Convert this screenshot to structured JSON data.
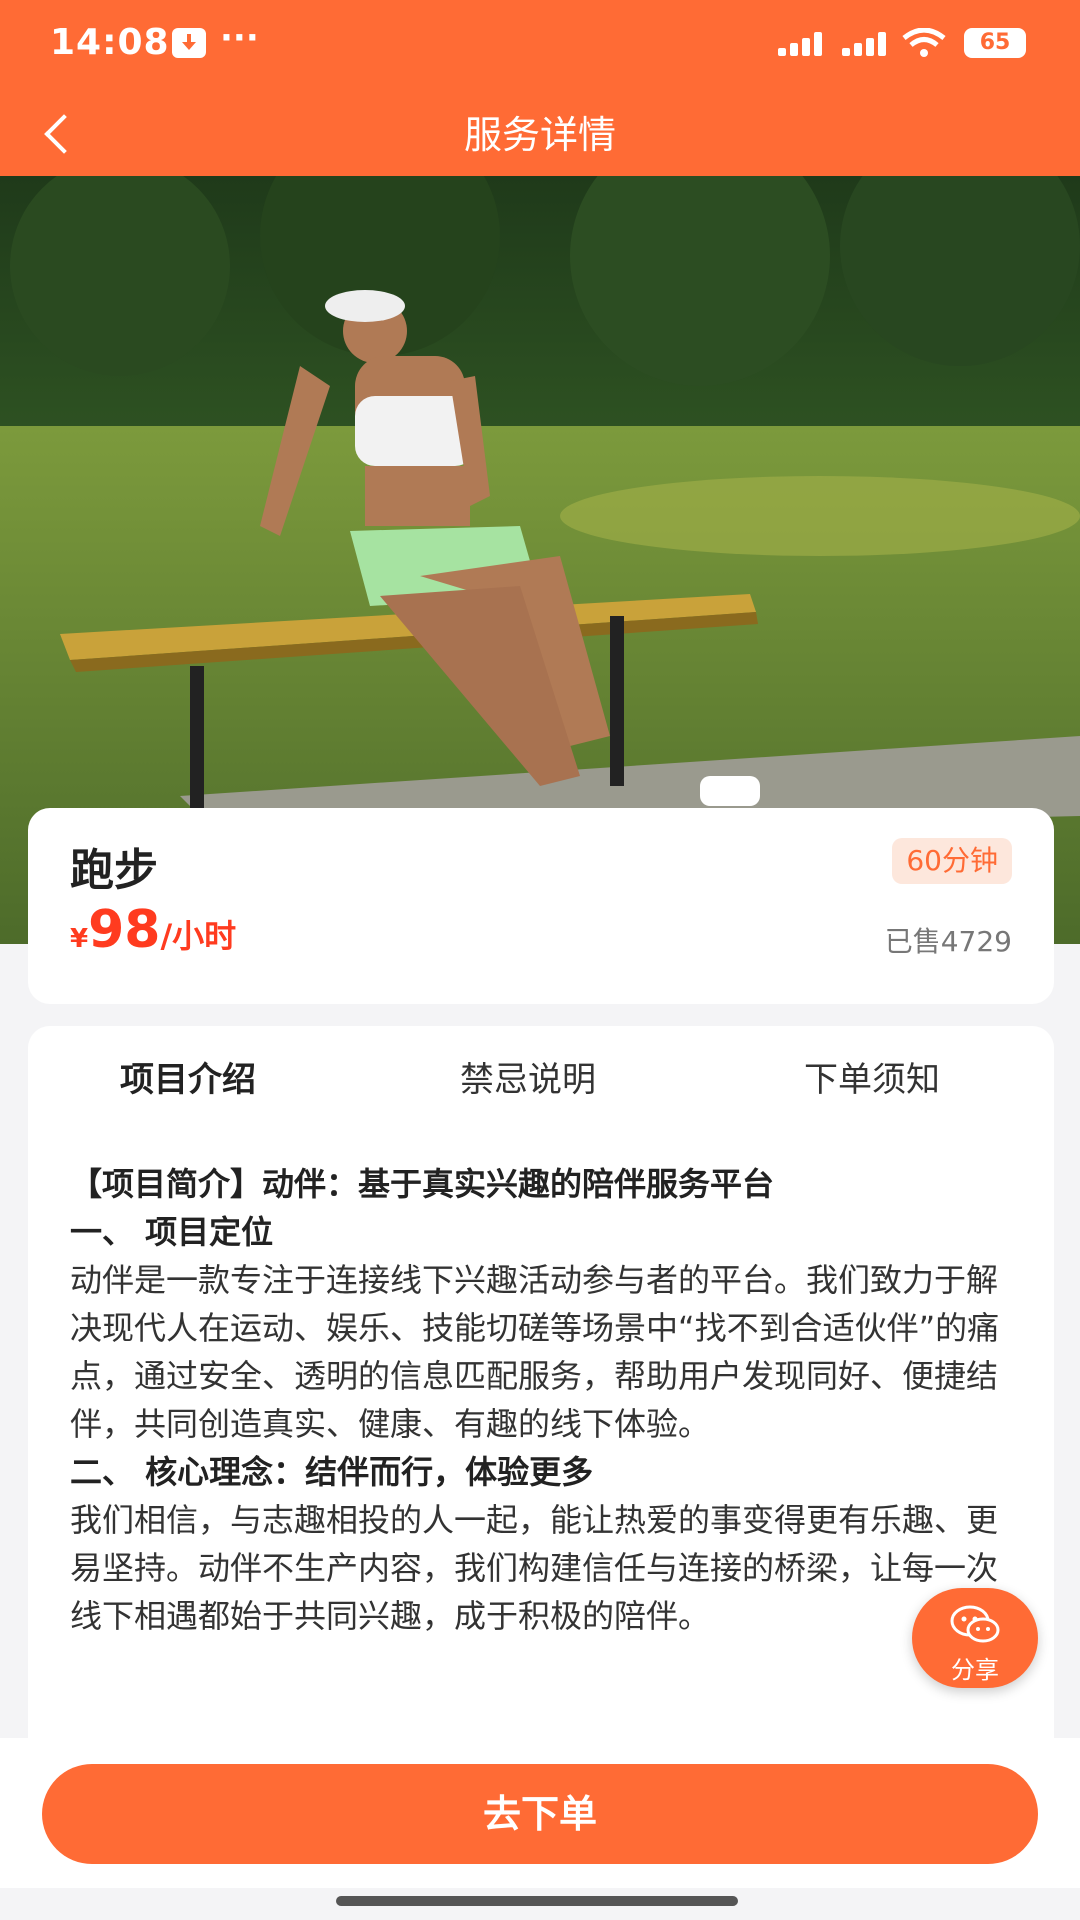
{
  "status_bar": {
    "time": "14:08",
    "more": "···",
    "battery": "65"
  },
  "navbar": {
    "title": "服务详情"
  },
  "service": {
    "name": "跑步",
    "duration": "60分钟",
    "price_symbol": "¥",
    "price": "98",
    "price_unit": "/小时",
    "sold": "已售4729"
  },
  "tabs": [
    {
      "label": "项目介绍",
      "active": true
    },
    {
      "label": "禁忌说明",
      "active": false
    },
    {
      "label": "下单须知",
      "active": false
    }
  ],
  "content": {
    "heading": "【项目简介】动伴：基于真实兴趣的陪伴服务平台",
    "section1_title": "一、 项目定位",
    "section1_body": "动伴是一款专注于连接线下兴趣活动参与者的平台。我们致力于解决现代人在运动、娱乐、技能切磋等场景中“找不到合适伙伴”的痛点，通过安全、透明的信息匹配服务，帮助用户发现同好、便捷结伴，共同创造真实、健康、有趣的线下体验。",
    "section2_title": "二、 核心理念：结伴而行，体验更多",
    "section2_body": "我们相信，与志趣相投的人一起，能让热爱的事变得更有乐趣、更易坚持。动伴不生产内容，我们构建信任与连接的桥梁，让每一次线下相遇都始于共同兴趣，成于积极的陪伴。"
  },
  "share": {
    "label": "分享",
    "icon": "wechat-icon"
  },
  "order_button": {
    "label": "去下单"
  },
  "colors": {
    "brand": "#ff6b35",
    "price": "#ff3b1f",
    "tag_bg": "#fde7dc"
  }
}
